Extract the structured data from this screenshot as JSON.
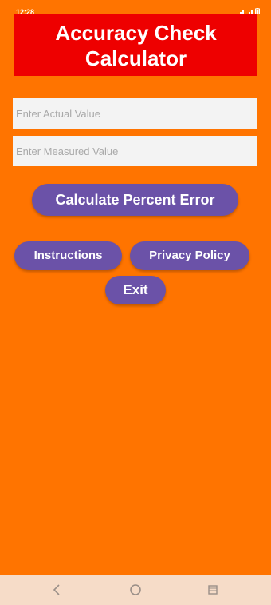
{
  "status_bar": {
    "time": "12:28",
    "icons": [
      "signal-icon",
      "wifi-icon",
      "battery-icon"
    ]
  },
  "header": {
    "title_line1": "Accuracy Check",
    "title_line2": "Calculator",
    "background_color": "#ee0000"
  },
  "form": {
    "actual_placeholder": "Enter Actual Value",
    "actual_value": "",
    "measured_placeholder": "Enter Measured Value",
    "measured_value": ""
  },
  "buttons": {
    "calculate_label": "Calculate Percent Error",
    "instructions_label": "Instructions",
    "privacy_label": "Privacy Policy",
    "exit_label": "Exit",
    "color": "#6b52a8"
  },
  "navigation": {
    "items": [
      "back-icon",
      "home-icon",
      "recents-icon"
    ]
  },
  "theme": {
    "background": "#ff7400",
    "nav_bar": "#f6dcc8"
  }
}
